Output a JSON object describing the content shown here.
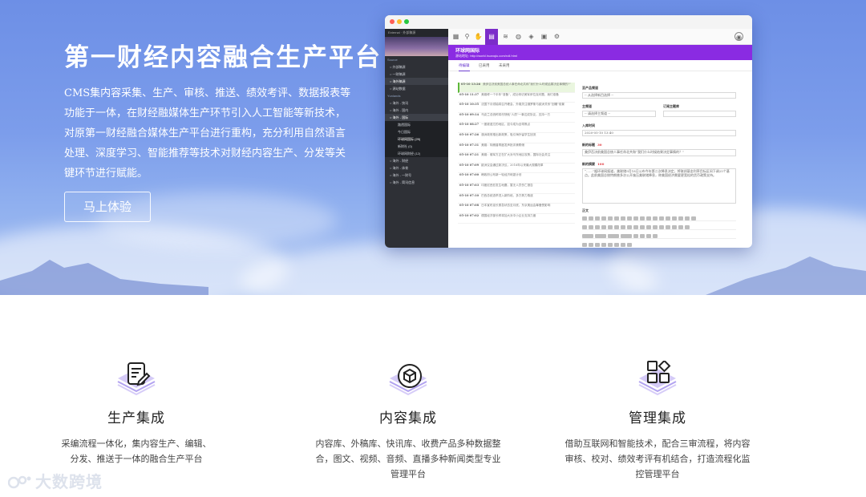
{
  "hero": {
    "title": "第一财经内容融合生产平台",
    "description": "CMS集内容采集、生产、审核、推送、绩效考评、数据报表等功能于一体，在财经融媒体生产环节引入人工智能等新技术，对原第一财经融合媒体生产平台进行重构，充分利用自然语言处理、深度学习、智能推荐等技术对财经内容生产、分发等关键环节进行赋能。",
    "cta_label": "马上体验"
  },
  "mock": {
    "window_title": "External · 外部稿源",
    "sidebar": [
      {
        "label": "Source",
        "type": "hdr"
      },
      {
        "label": "○ 外部稿源",
        "type": "item"
      },
      {
        "label": "○ 一财稿源",
        "type": "item"
      },
      {
        "label": "○ 海外稿源",
        "type": "sel"
      },
      {
        "label": "○ 源站数据",
        "type": "item"
      },
      {
        "label": "Yunlands",
        "type": "hdr"
      },
      {
        "label": "○ 海外 - 快讯",
        "type": "item"
      },
      {
        "label": "○ 海外 - 国内",
        "type": "item"
      },
      {
        "label": "○ 海外 - 国际",
        "type": "sel"
      },
      {
        "label": "路透国际",
        "type": "sub"
      },
      {
        "label": "今日国际",
        "type": "sub"
      },
      {
        "label": "环球网国际 (29)",
        "type": "subsel"
      },
      {
        "label": "新财社 (0)",
        "type": "sub"
      },
      {
        "label": "环球网财经 (12)",
        "type": "sub"
      },
      {
        "label": "○ 海外 - 财经",
        "type": "item"
      },
      {
        "label": "○ 海外 - 体育",
        "type": "item"
      },
      {
        "label": "○ 海外 - 一财号",
        "type": "item"
      },
      {
        "label": "○ 海外 - 简讯信息",
        "type": "item"
      }
    ],
    "bar_title": "环球网国际",
    "bar_url": "源站地址: http://world.huanqiu.com/roll.html",
    "tabs": [
      "待编辑",
      "已采用",
      "未采用"
    ],
    "news": [
      {
        "time": "05-10 13:26",
        "text": "美伊否决前美国总统人事任命北共和“我们什么时候结果决定事情的?”",
        "hl": true
      },
      {
        "time": "05-10 11:37",
        "text": "美媒称一个半年\"准备\"，成功采访美军伊拉克问题，我们准备"
      },
      {
        "time": "05-10 10:35",
        "text": "法国下月领袖将召开峰会，外媒关注俄罗斯与欧洲关系\"回暖\"前景"
      },
      {
        "time": "05-10 09:14",
        "text": "乌克兰总统称将尽快就\"人质\"一事达成协议，支持一方"
      },
      {
        "time": "05-10 08:27",
        "text": "一度被遗忘的地区，如今成为全球焦点"
      },
      {
        "time": "05-10 07:26",
        "text": "澳洲政府推出新政策，吸引海外留学生回流"
      },
      {
        "time": "05-10 07:31",
        "text": "美媒：特朗普再度发声批评美联储"
      },
      {
        "time": "05-10 07:21",
        "text": "美媒：俄军方正在扩大对乌东地区攻势，国际社会关注"
      },
      {
        "time": "05-10 07:09",
        "text": "欧洲议会通过新决议，2016年以来最大规模改革"
      },
      {
        "time": "05-10 07:00",
        "text": "韩政府公布新一轮经济刺激计划"
      },
      {
        "time": "05-10 07:03",
        "text": "印度尼西亚发生地震，暂无人员伤亡报告"
      },
      {
        "time": "05-10 07:10",
        "text": "巴西总统选举进入新阶段，多方势力角逐"
      },
      {
        "time": "05-10 07:08",
        "text": "日本宣布延长紧急状态至月底，东京奥运会筹备受影响"
      },
      {
        "time": "05-10 07:02",
        "text": "德国经济部长称将加大对中小企业支持力度"
      }
    ],
    "form": {
      "product_label": "至产品频道",
      "product_value": "-- 从选择新目选择 --",
      "main_label": "主频道",
      "main_value": "-- 请选择主频道 --",
      "sub_label": "订阅主题库",
      "time_label": "入库时间",
      "time_value": "2020-05-10 13:40",
      "title_label": "新的标题",
      "title_count": "30",
      "title_value": "美伊否决前美国总统人事任命北共和“我们什么时候结果决定事情的？”",
      "summary_label": "新的摘要",
      "summary_count": "100",
      "summary_value": "“……”据环球网报道，美联储9月18日公布今年第二次降息决定，将联邦基金利率目标区间下调25个基点。此前美国总统特朗普多次公开施压美联储降息，称美国经济需要更宽松的货币政策支持。",
      "body_label": "正文"
    }
  },
  "features": [
    {
      "title": "生产集成",
      "desc": "采编流程一体化，集内容生产、编辑、分发、推送于一体的融合生产平台",
      "icon": "document-edit-icon"
    },
    {
      "title": "内容集成",
      "desc": "内容库、外稿库、快讯库、收费产品多种数据整合，图文、视频、音频、直播多种新闻类型专业管理平台",
      "icon": "cube-icon"
    },
    {
      "title": "管理集成",
      "desc": "借助互联网和智能技术，配合三审流程，将内容审核、校对、绩效考评有机结合，打造流程化监控管理平台",
      "icon": "grid-icon"
    }
  ],
  "watermark": "大数跨境",
  "colors": {
    "accent_purple": "#8a2be2",
    "icon_purple": "#7b5ce6",
    "hero_blue": "#7c9deb"
  }
}
